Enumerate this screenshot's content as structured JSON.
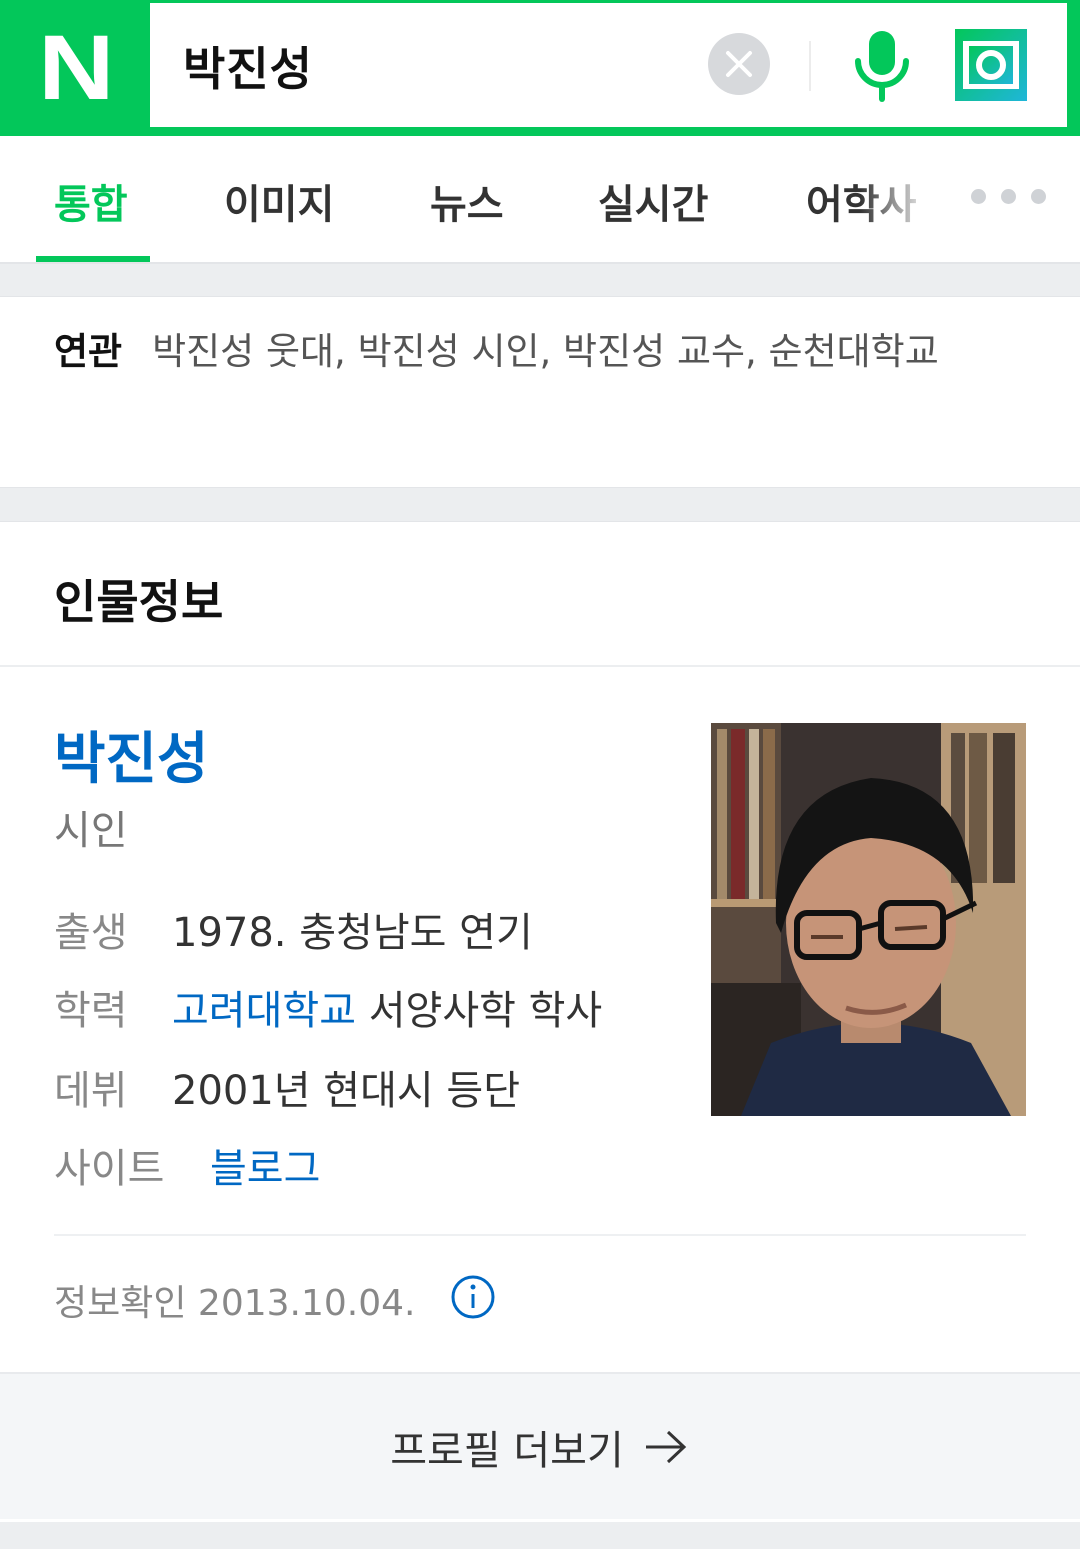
{
  "header": {
    "logo_text": "N",
    "search_value": "박진성",
    "icons": [
      "clear-icon",
      "microphone-icon",
      "lens-search-icon"
    ],
    "accent_color": "#03c75a"
  },
  "tabs": [
    {
      "label": "통합",
      "active": true
    },
    {
      "label": "이미지",
      "active": false
    },
    {
      "label": "뉴스",
      "active": false
    },
    {
      "label": "실시간",
      "active": false
    },
    {
      "label": "어학사",
      "active": false
    }
  ],
  "related": {
    "label": "연관",
    "text": "박진성 웃대, 박진성 시인, 박진성 교수, 순천대학교"
  },
  "person": {
    "section_title": "인물정보",
    "name": "박진성",
    "occupation": "시인",
    "birth_label": "출생",
    "birth_value": "1978. 충청남도 연기",
    "education_label": "학력",
    "education_school": "고려대학교",
    "education_rest": "서양사학 학사",
    "debut_label": "데뷔",
    "debut_value": "2001년 현대시 등단",
    "site_label": "사이트",
    "site_value": "블로그",
    "verified": "정보확인 2013.10.04.",
    "more_button": "프로필 더보기",
    "link_color": "#0068c3"
  }
}
